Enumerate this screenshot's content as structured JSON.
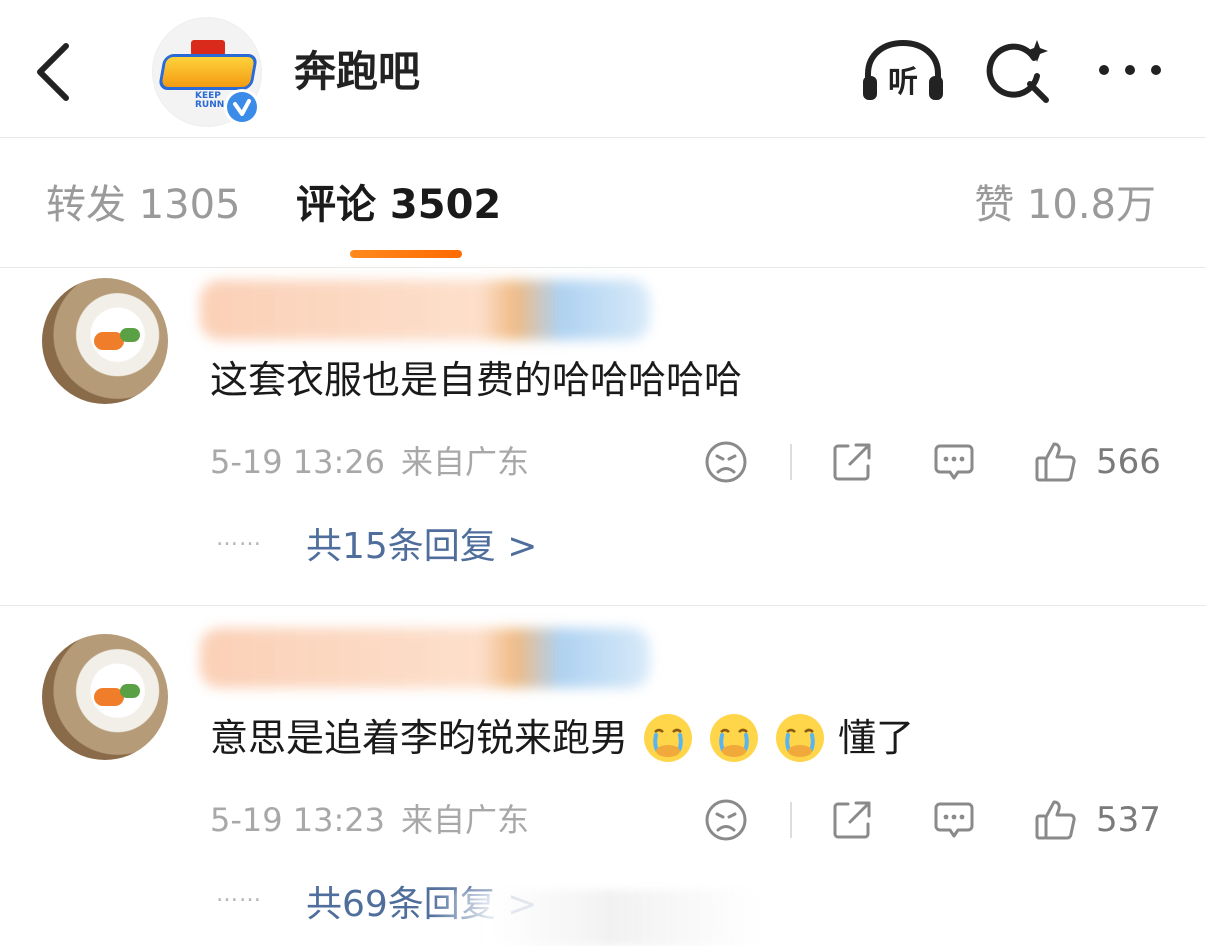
{
  "header": {
    "title": "奔跑吧",
    "listen_label": "听",
    "avatar_logo_sub": "KEEP RUNNING",
    "icons": [
      "chevron-left-icon",
      "headphones-icon",
      "search-sparkle-icon",
      "more-dots-icon"
    ]
  },
  "tabs": {
    "repost_label": "转发 1305",
    "comment_label": "评论 3502",
    "like_label": "赞 10.8万",
    "active": "comment"
  },
  "comments": [
    {
      "text": "这套衣服也是自费的哈哈哈哈哈",
      "time": "5-19 13:26",
      "location": "来自广东",
      "likes": "566",
      "dots": "……",
      "replies": "共15条回复 >"
    },
    {
      "text": "意思是追着李昀锐来跑男",
      "text_after": "懂了",
      "emoji": "crying-face-emoji",
      "emoji_count": 3,
      "time": "5-19 13:23",
      "location": "来自广东",
      "likes": "537",
      "dots": "……",
      "replies": "共69条回复 >"
    }
  ],
  "colors": {
    "accent": "#ff7a00",
    "link": "#4f6e9c",
    "verify": "#3a8ce8",
    "muted_text": "#a8a8a8"
  }
}
